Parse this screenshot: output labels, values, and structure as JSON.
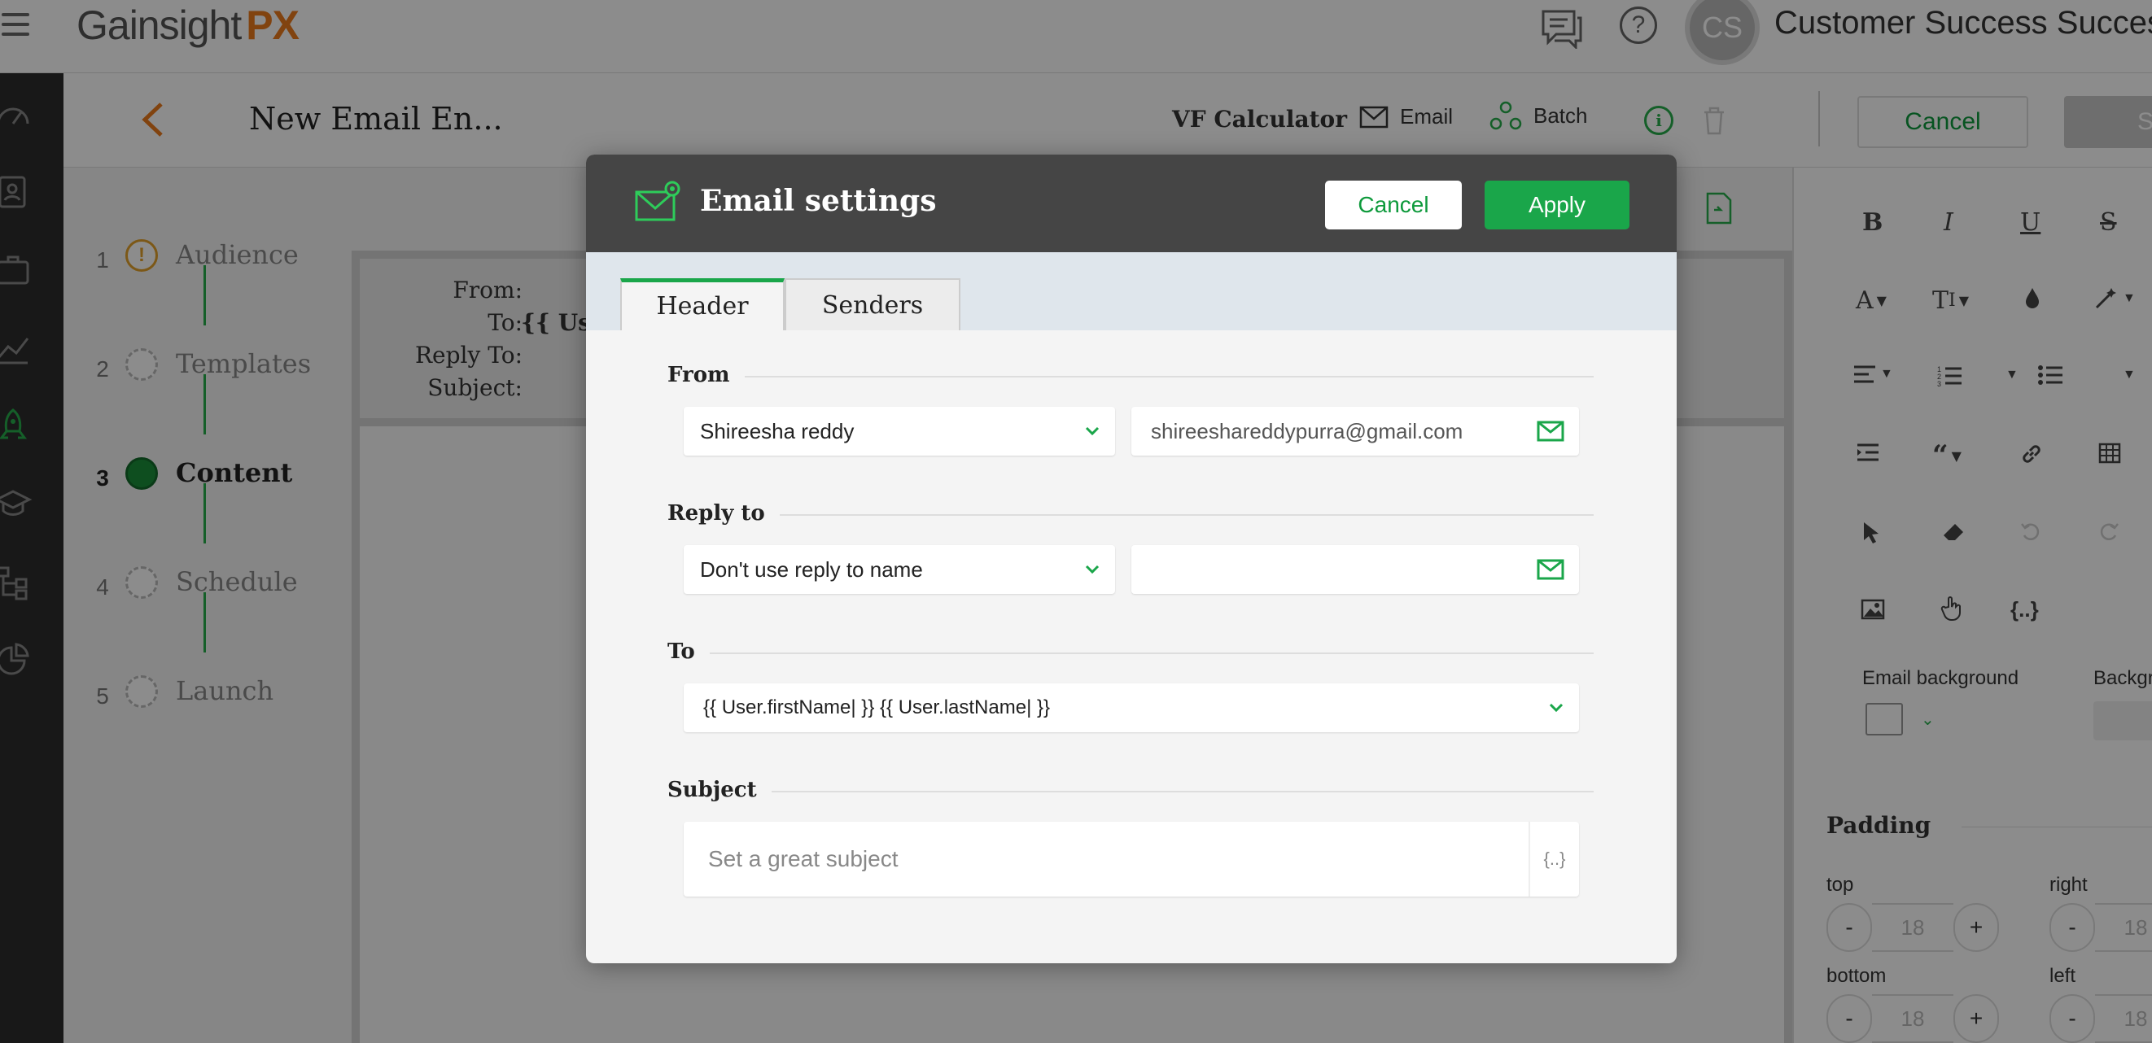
{
  "topbar": {
    "logo_main": "Gainsight",
    "logo_px": "PX",
    "avatar_initials": "CS",
    "account_name": "Customer Success Success"
  },
  "subheader": {
    "page_title": "New Email En...",
    "calculator_label": "VF Calculator",
    "email_label": "Email",
    "batch_label": "Batch",
    "cancel_label": "Cancel",
    "save_label": "Sa"
  },
  "steps": [
    {
      "num": "1",
      "label": "Audience",
      "state": "warning"
    },
    {
      "num": "2",
      "label": "Templates",
      "state": "pending"
    },
    {
      "num": "3",
      "label": "Content",
      "state": "active"
    },
    {
      "num": "4",
      "label": "Schedule",
      "state": "pending"
    },
    {
      "num": "5",
      "label": "Launch",
      "state": "pending"
    }
  ],
  "preview": {
    "from_label": "From:",
    "to_label": "To:",
    "to_value": "{{ User",
    "reply_to_label": "Reply To:",
    "subject_label": "Subject:"
  },
  "rightpanel": {
    "email_background_label": "Email background",
    "background_label": "Backgr",
    "padding_label": "Padding",
    "top_label": "top",
    "right_label": "right",
    "bottom_label": "bottom",
    "left_label": "left",
    "padding_top": "18",
    "padding_right": "18",
    "padding_bottom": "18",
    "padding_left": "18"
  },
  "modal": {
    "title": "Email settings",
    "cancel_label": "Cancel",
    "apply_label": "Apply",
    "tabs": [
      {
        "label": "Header",
        "active": true
      },
      {
        "label": "Senders",
        "active": false
      }
    ],
    "from": {
      "label": "From",
      "name_value": "Shireesha reddy",
      "email_value": "shireeshareddypurra@gmail.com"
    },
    "reply_to": {
      "label": "Reply to",
      "name_value": "Don't use reply to name",
      "email_value": ""
    },
    "to": {
      "label": "To",
      "value": "{{ User.firstName| }} {{ User.lastName| }}"
    },
    "subject": {
      "label": "Subject",
      "placeholder": "Set a great subject",
      "token_label": "{..}"
    }
  },
  "colors": {
    "accent_green": "#1aa64a",
    "brand_orange": "#ec7a1c",
    "modal_header": "#454545"
  }
}
